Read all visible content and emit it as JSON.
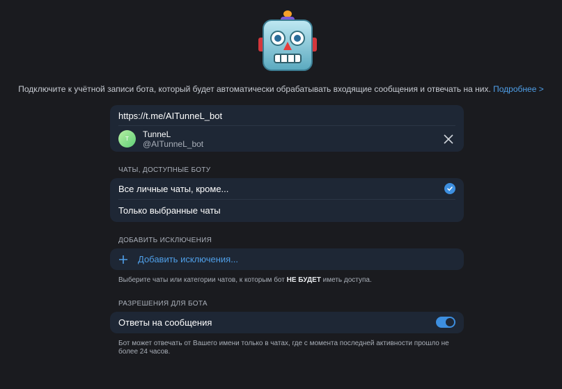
{
  "intro": {
    "text": "Подключите к учётной записи бота, который будет автоматически обрабатывать входящие сообщения и отвечать на них.",
    "link": "Подробнее >"
  },
  "bot": {
    "url": "https://t.me/AITunneL_bot",
    "avatar_letter": "T",
    "name": "TunneL",
    "username": "@AITunneL_bot"
  },
  "chats_section": {
    "header": "ЧАТЫ, ДОСТУПНЫЕ БОТУ",
    "options": [
      {
        "label": "Все личные чаты, кроме...",
        "selected": true
      },
      {
        "label": "Только выбранные чаты",
        "selected": false
      }
    ]
  },
  "exclusions_section": {
    "header": "ДОБАВИТЬ ИСКЛЮЧЕНИЯ",
    "add_label": "Добавить исключения...",
    "hint_before": "Выберите чаты или категории чатов, к которым бот ",
    "hint_bold": "НЕ БУДЕТ",
    "hint_after": " иметь доступа."
  },
  "permissions_section": {
    "header": "РАЗРЕШЕНИЯ ДЛЯ БОТА",
    "reply_label": "Ответы на сообщения",
    "reply_enabled": true,
    "hint_line1": "Бот может отвечать от Вашего имени только в чатах, где с момента последней активности прошло не",
    "hint_line2": "более 24 часов."
  },
  "colors": {
    "background": "#1a1b1f",
    "card": "#1e2735",
    "accent": "#3d8fe0",
    "link": "#4f9fe8"
  }
}
